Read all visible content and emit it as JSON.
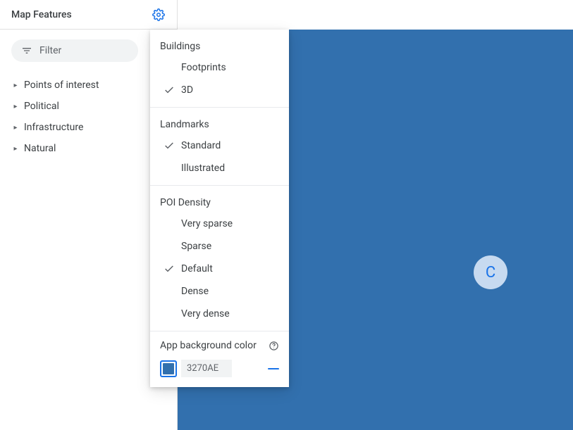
{
  "colors": {
    "accent": "#1a73e8",
    "canvas": "#3270AE"
  },
  "sidebar": {
    "title": "Map Features",
    "filter_placeholder": "Filter",
    "items": [
      {
        "label": "Points of interest"
      },
      {
        "label": "Political"
      },
      {
        "label": "Infrastructure"
      },
      {
        "label": "Natural"
      }
    ]
  },
  "avatar": {
    "initial": "C"
  },
  "settings": {
    "sections": [
      {
        "heading": "Buildings",
        "items": [
          {
            "label": "Footprints",
            "selected": false
          },
          {
            "label": "3D",
            "selected": true
          }
        ]
      },
      {
        "heading": "Landmarks",
        "items": [
          {
            "label": "Standard",
            "selected": true
          },
          {
            "label": "Illustrated",
            "selected": false
          }
        ]
      },
      {
        "heading": "POI Density",
        "items": [
          {
            "label": "Very sparse",
            "selected": false
          },
          {
            "label": "Sparse",
            "selected": false
          },
          {
            "label": "Default",
            "selected": true
          },
          {
            "label": "Dense",
            "selected": false
          },
          {
            "label": "Very dense",
            "selected": false
          }
        ]
      }
    ],
    "bgcolor": {
      "label": "App background color",
      "hex": "3270AE"
    }
  }
}
